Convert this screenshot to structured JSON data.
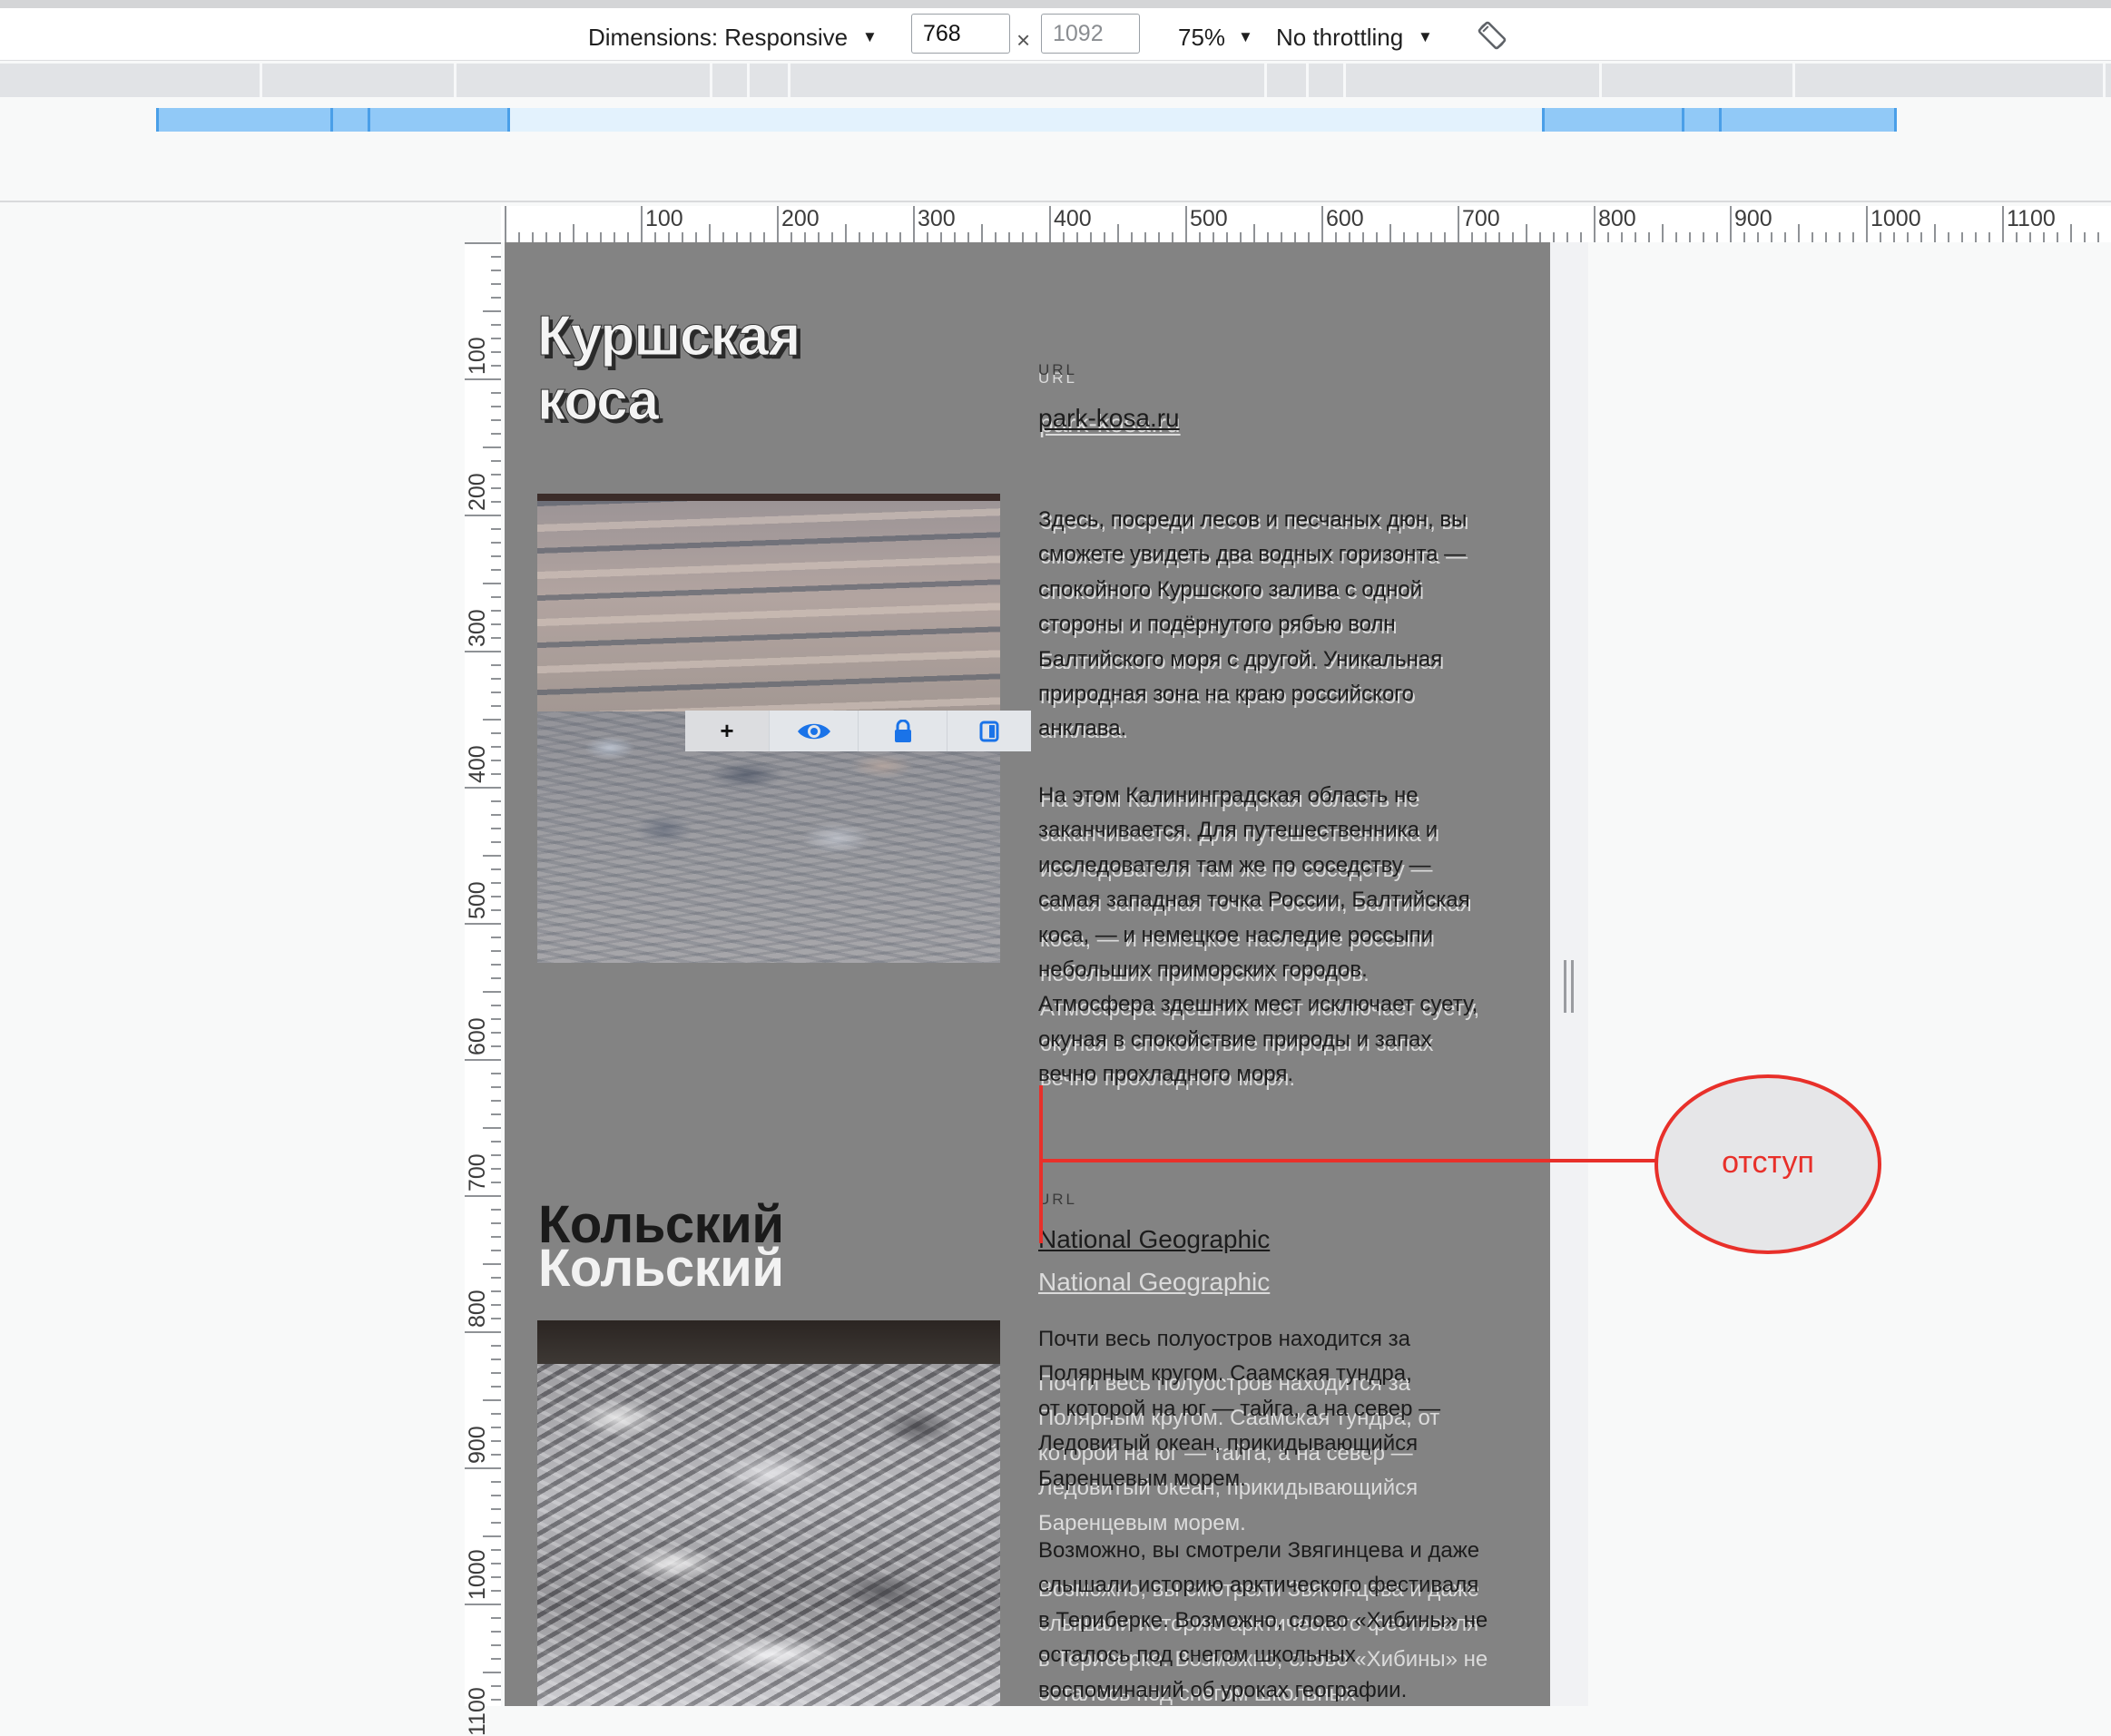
{
  "devtools": {
    "dimensions_label": "Dimensions: Responsive",
    "width_value": "768",
    "times": "×",
    "height_placeholder": "1092",
    "zoom": "75%",
    "throttling": "No throttling"
  },
  "icons": {
    "dimensions_caret": "caret-down-icon",
    "zoom_caret": "caret-down-icon",
    "throttling_caret": "caret-down-icon",
    "rotate": "rotate-icon",
    "overlay_add": "plus-icon",
    "overlay_visibility": "eye-icon",
    "overlay_lock": "lock-icon",
    "overlay_invert": "invert-icon"
  },
  "ruler": {
    "horizontal_labels": [
      "100",
      "200",
      "300",
      "400",
      "500",
      "600",
      "700",
      "800",
      "900",
      "1000",
      "1100"
    ],
    "vertical_labels": [
      "100",
      "200",
      "300",
      "400",
      "500",
      "600",
      "700",
      "800",
      "900",
      "1000",
      "1100"
    ]
  },
  "overlay_toolbar": {
    "add_label": "+"
  },
  "kursh": {
    "title_lines": [
      "Куршская",
      "коса"
    ],
    "url_label": "URL",
    "link": "park-kosa.ru",
    "paragraph_1": [
      "Здесь, посреди лесов и песчаных дюн, вы",
      "сможете увидеть два водных горизонта —",
      "спокойного Куршского залива с одной",
      "стороны и подёрнутого рябью волн",
      "Балтийского моря с другой. Уникальная",
      "природная зона на краю российского",
      "анклава."
    ],
    "paragraph_2": [
      "На этом Калининградская область не",
      "заканчивается. Для путешественника и",
      "исследователя там же по соседству —",
      "самая западная точка России, Балтийская",
      "коса, — и немецкое наследие россыпи",
      "небольших приморских городов.",
      "Атмосфера здешних мест исключает суету,",
      "окуная в спокойствие природы и запах",
      "вечно прохладного моря."
    ]
  },
  "kolsky": {
    "title": "Кольский",
    "url_label": "URL",
    "link": "National Geographic",
    "paragraph_1_page": [
      "Почти весь полуостров находится за",
      "Полярным кругом. Саамская тундра,",
      "от которой на юг — тайга, а на север —",
      "Ледовитый океан, прикидывающийся",
      "Баренцевым морем."
    ],
    "paragraph_1_overlay": [
      "Почти весь полуостров находится за",
      "Полярным кругом. Саамская тундра, от",
      "которой на юг — тайга, а на север —",
      "Ледовитый океан, прикидывающийся",
      "Баренцевым морем."
    ],
    "paragraph_2_page": [
      "Возможно, вы смотрели Звягинцева и даже",
      "слышали историю арктического фестиваля",
      "в Териберке. Возможно, слово «Хибины» не",
      "осталось под снегом школьных",
      "воспоминаний об уроках географии."
    ],
    "paragraph_2_overlay": [
      "Возможно, вы смотрели Звягинцева и даже",
      "слышали историю арктического фестиваля",
      "в Териберке. Возможно, слово «Хибины» не",
      "осталось под снегом школьных"
    ]
  },
  "annotation": {
    "label": "отступ",
    "color": "#e8302a"
  },
  "colors": {
    "canvas": "#838383",
    "overlay_icon_accent": "#1a73e8",
    "media_query_bar": "#91c9f7",
    "media_query_inner": "#e3f2fd"
  }
}
